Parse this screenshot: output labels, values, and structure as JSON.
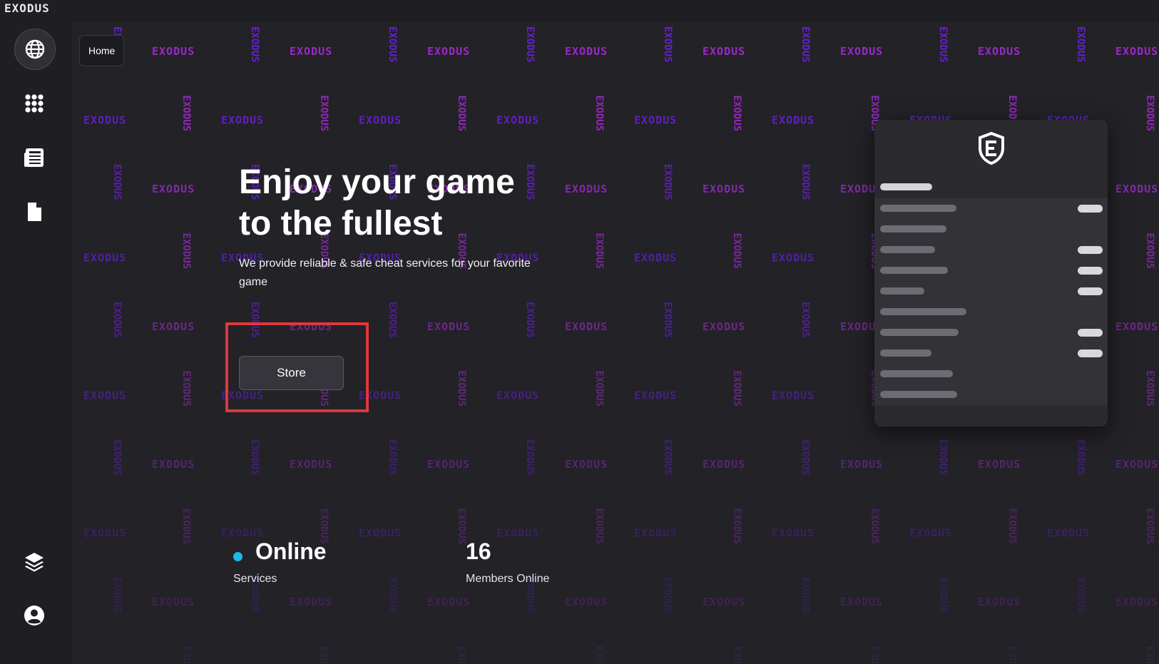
{
  "app": {
    "brand": "EXODUS",
    "accent_color": "#1fb6ea",
    "pattern_colors": [
      "#a22ad0",
      "#6a1fd6"
    ]
  },
  "sidebar": {
    "items": [
      {
        "name": "globe",
        "icon": "globe-icon",
        "active": true
      },
      {
        "name": "apps",
        "icon": "grid-icon",
        "active": false
      },
      {
        "name": "news",
        "icon": "newspaper-icon",
        "active": false
      },
      {
        "name": "docs",
        "icon": "document-icon",
        "active": false
      },
      {
        "name": "layers",
        "icon": "layers-icon",
        "active": false
      },
      {
        "name": "account",
        "icon": "user-icon",
        "active": false
      }
    ]
  },
  "breadcrumb": {
    "label": "Home"
  },
  "hero": {
    "title_line1": "Enjoy your game",
    "title_line2": "to the fullest",
    "subtitle": "We provide reliable & safe cheat services for your favorite game",
    "store_label": "Store"
  },
  "stats": {
    "status_value": "Online",
    "status_label": "Services",
    "members_value": "16",
    "members_label": "Members Online"
  },
  "panel": {
    "logo_icon": "exodus-shield-icon",
    "rows": [
      {
        "toggle": true
      },
      {
        "toggle": false
      },
      {
        "toggle": true
      },
      {
        "toggle": true
      },
      {
        "toggle": true
      },
      {
        "toggle": false
      },
      {
        "toggle": true
      },
      {
        "toggle": true
      },
      {
        "toggle": false
      },
      {
        "toggle": false
      }
    ]
  }
}
